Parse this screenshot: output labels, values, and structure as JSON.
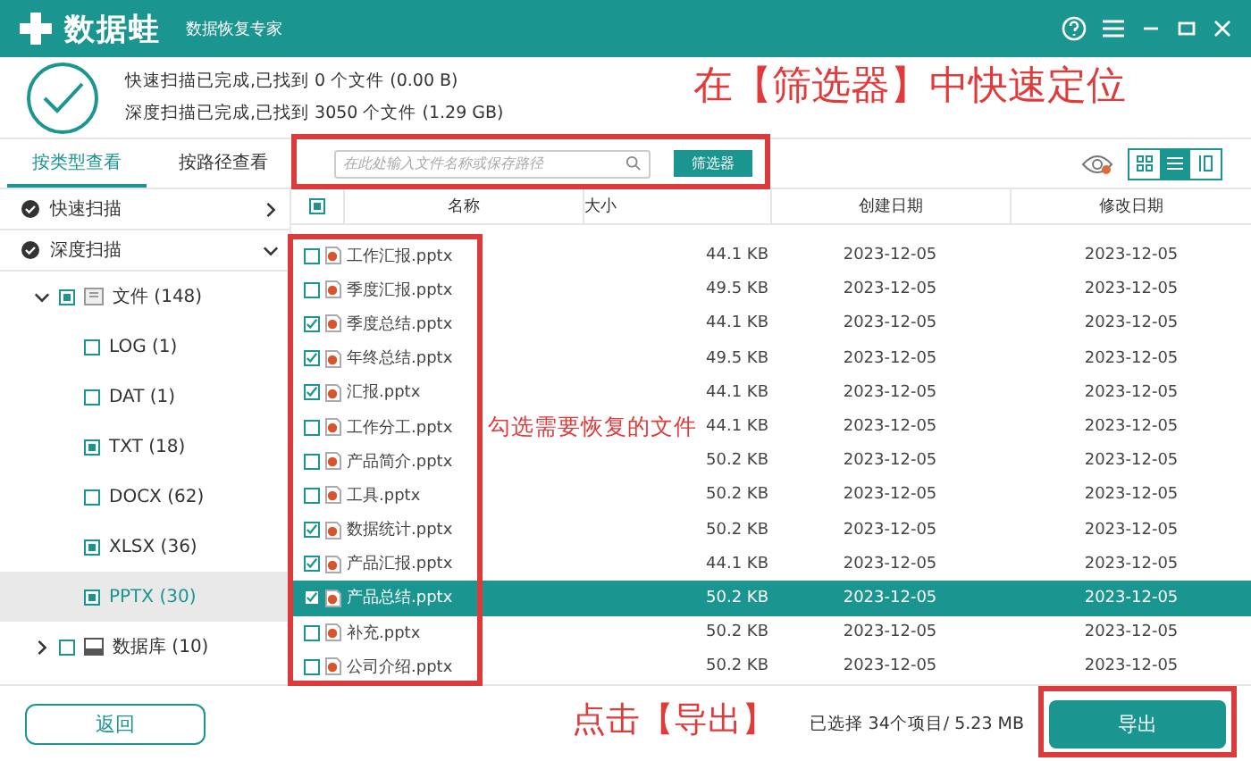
{
  "app": {
    "title": "数据蛙",
    "subtitle": "数据恢复专家"
  },
  "scan_status": [
    "快速扫描已完成,已找到 0 个文件 (0.00  B)",
    "深度扫描已完成,已找到 3050 个文件 (1.29 GB)"
  ],
  "view_tabs": [
    {
      "label": "按类型查看",
      "selected": true
    },
    {
      "label": "按路径查看",
      "selected": false
    }
  ],
  "search": {
    "placeholder": "在此处输入文件名称或保存路径"
  },
  "filter_button": "筛选器",
  "view_modes": [
    {
      "kind": "grid",
      "selected": false
    },
    {
      "kind": "list",
      "selected": true
    },
    {
      "kind": "detail",
      "selected": false
    }
  ],
  "scans": [
    {
      "label": "快速扫描",
      "expanded": false
    },
    {
      "label": "深度扫描",
      "expanded": true
    }
  ],
  "tree": [
    {
      "label": "文件 (148)",
      "kind": "folder",
      "expanded": true,
      "partial": true,
      "selected": false,
      "children": [
        {
          "label": "LOG (1)",
          "partial": false,
          "selected": false
        },
        {
          "label": "DAT (1)",
          "partial": false,
          "selected": false
        },
        {
          "label": "TXT (18)",
          "partial": true,
          "selected": false
        },
        {
          "label": "DOCX (62)",
          "partial": false,
          "selected": false
        },
        {
          "label": "XLSX (36)",
          "partial": true,
          "selected": false
        },
        {
          "label": "PPTX (30)",
          "partial": true,
          "selected": true
        }
      ]
    },
    {
      "label": "数据库 (10)",
      "kind": "database",
      "expanded": false,
      "partial": false,
      "selected": false
    }
  ],
  "table": {
    "header_partial": true,
    "columns": [
      "名称",
      "大小",
      "创建日期",
      "修改日期"
    ],
    "rows": [
      {
        "name": "工作汇报.pptx",
        "size": "44.1 KB",
        "created": "2023-12-05",
        "modified": "2023-12-05",
        "checked": false,
        "selected": false
      },
      {
        "name": "季度汇报.pptx",
        "size": "49.5 KB",
        "created": "2023-12-05",
        "modified": "2023-12-05",
        "checked": false,
        "selected": false
      },
      {
        "name": "季度总结.pptx",
        "size": "44.1 KB",
        "created": "2023-12-05",
        "modified": "2023-12-05",
        "checked": true,
        "selected": false
      },
      {
        "name": "年终总结.pptx",
        "size": "49.5 KB",
        "created": "2023-12-05",
        "modified": "2023-12-05",
        "checked": true,
        "selected": false
      },
      {
        "name": "汇报.pptx",
        "size": "44.1 KB",
        "created": "2023-12-05",
        "modified": "2023-12-05",
        "checked": true,
        "selected": false
      },
      {
        "name": "工作分工.pptx",
        "size": "44.1 KB",
        "created": "2023-12-05",
        "modified": "2023-12-05",
        "checked": false,
        "selected": false
      },
      {
        "name": "产品简介.pptx",
        "size": "50.2 KB",
        "created": "2023-12-05",
        "modified": "2023-12-05",
        "checked": false,
        "selected": false
      },
      {
        "name": "工具.pptx",
        "size": "50.2 KB",
        "created": "2023-12-05",
        "modified": "2023-12-05",
        "checked": false,
        "selected": false
      },
      {
        "name": "数据统计.pptx",
        "size": "50.2 KB",
        "created": "2023-12-05",
        "modified": "2023-12-05",
        "checked": true,
        "selected": false
      },
      {
        "name": "产品汇报.pptx",
        "size": "44.1 KB",
        "created": "2023-12-05",
        "modified": "2023-12-05",
        "checked": true,
        "selected": false
      },
      {
        "name": "产品总结.pptx",
        "size": "50.2 KB",
        "created": "2023-12-05",
        "modified": "2023-12-05",
        "checked": true,
        "selected": true
      },
      {
        "name": "补充.pptx",
        "size": "50.2 KB",
        "created": "2023-12-05",
        "modified": "2023-12-05",
        "checked": false,
        "selected": false
      },
      {
        "name": "公司介绍.pptx",
        "size": "50.2 KB",
        "created": "2023-12-05",
        "modified": "2023-12-05",
        "checked": false,
        "selected": false
      }
    ]
  },
  "footer": {
    "back_button": "返回",
    "selection_info": "已选择 34个项目/ 5.23 MB",
    "export_button": "导出"
  },
  "annotations": [
    {
      "kind": "filter",
      "text": "在【筛选器】中快速定位"
    },
    {
      "kind": "select",
      "text": "勾选需要恢复的文件"
    },
    {
      "kind": "export",
      "text": "点击【导出】"
    }
  ]
}
